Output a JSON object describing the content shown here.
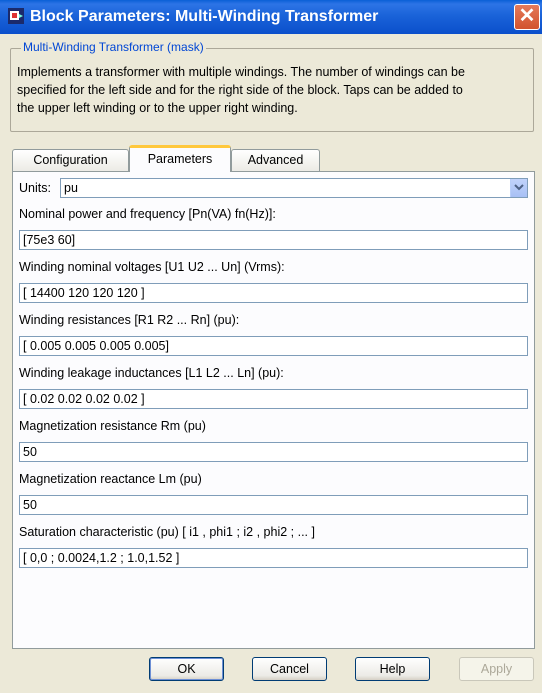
{
  "window": {
    "title": "Block Parameters: Multi-Winding Transformer",
    "close_label": "✕"
  },
  "mask": {
    "group_label": "Multi-Winding Transformer (mask)",
    "description_lines": [
      "Implements a transformer with multiple windings. The number of windings can be",
      "specified for the left side and for the right side of the block. Taps can be added to",
      "the upper left winding or to the upper right winding."
    ]
  },
  "tabs": [
    {
      "label": "Configuration",
      "active": false
    },
    {
      "label": "Parameters",
      "active": true
    },
    {
      "label": "Advanced",
      "active": false
    }
  ],
  "params": {
    "units_label": "Units:",
    "units_value": "pu",
    "fields": [
      {
        "label": "Nominal power and frequency [Pn(VA) fn(Hz)]:",
        "value": "[75e3 60]"
      },
      {
        "label": "Winding nominal voltages [U1 U2 ... Un] (Vrms):",
        "value": "[ 14400  120  120 120 ]"
      },
      {
        "label": "Winding resistances [R1 R2 ... Rn] (pu):",
        "value": "[ 0.005  0.005  0.005  0.005]"
      },
      {
        "label": "Winding leakage inductances [L1 L2 ... Ln] (pu):",
        "value": "[ 0.02  0.02  0.02  0.02 ]"
      },
      {
        "label": "Magnetization resistance Rm (pu)",
        "value": "50"
      },
      {
        "label": "Magnetization reactance Lm (pu)",
        "value": "50"
      },
      {
        "label": "Saturation characteristic (pu) [ i1 , phi1 ; i2 , phi2 ; ... ]",
        "value": "[ 0,0 ; 0.0024,1.2 ; 1.0,1.52 ]"
      }
    ]
  },
  "buttons": {
    "ok": "OK",
    "cancel": "Cancel",
    "help": "Help",
    "apply": "Apply"
  }
}
